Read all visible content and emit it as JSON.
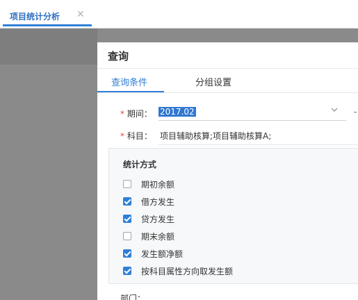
{
  "tabbar": {
    "tab_label": "项目统计分析",
    "close_glyph": "✕"
  },
  "dialog": {
    "title": "查询",
    "tabs": [
      {
        "label": "查询条件",
        "active": true
      },
      {
        "label": "分组设置",
        "active": false
      }
    ],
    "period": {
      "required_mark": "*",
      "label": "期间：",
      "value": "2017.02",
      "range_separator": "-"
    },
    "subject": {
      "required_mark": "*",
      "label": "科目：",
      "value": "项目辅助核算;项目辅助核算A;"
    },
    "stat_method": {
      "title": "统计方式",
      "options": [
        {
          "label": "期初余额",
          "checked": false
        },
        {
          "label": "借方发生",
          "checked": true
        },
        {
          "label": "贷方发生",
          "checked": true
        },
        {
          "label": "期末余额",
          "checked": false
        },
        {
          "label": "发生额净额",
          "checked": true
        },
        {
          "label": "按科目属性方向取发生额",
          "checked": true
        }
      ]
    },
    "department": {
      "label": "部门："
    }
  },
  "colors": {
    "accent": "#2f7fd6",
    "overlay": "#8a8a8a",
    "required": "#e74c3c"
  },
  "icons": {
    "tab_close": "close-icon",
    "select_arrow": "chevron-down-icon",
    "checkbox_checked": "checkbox-checked-icon",
    "checkbox_unchecked": "checkbox-unchecked-icon"
  }
}
